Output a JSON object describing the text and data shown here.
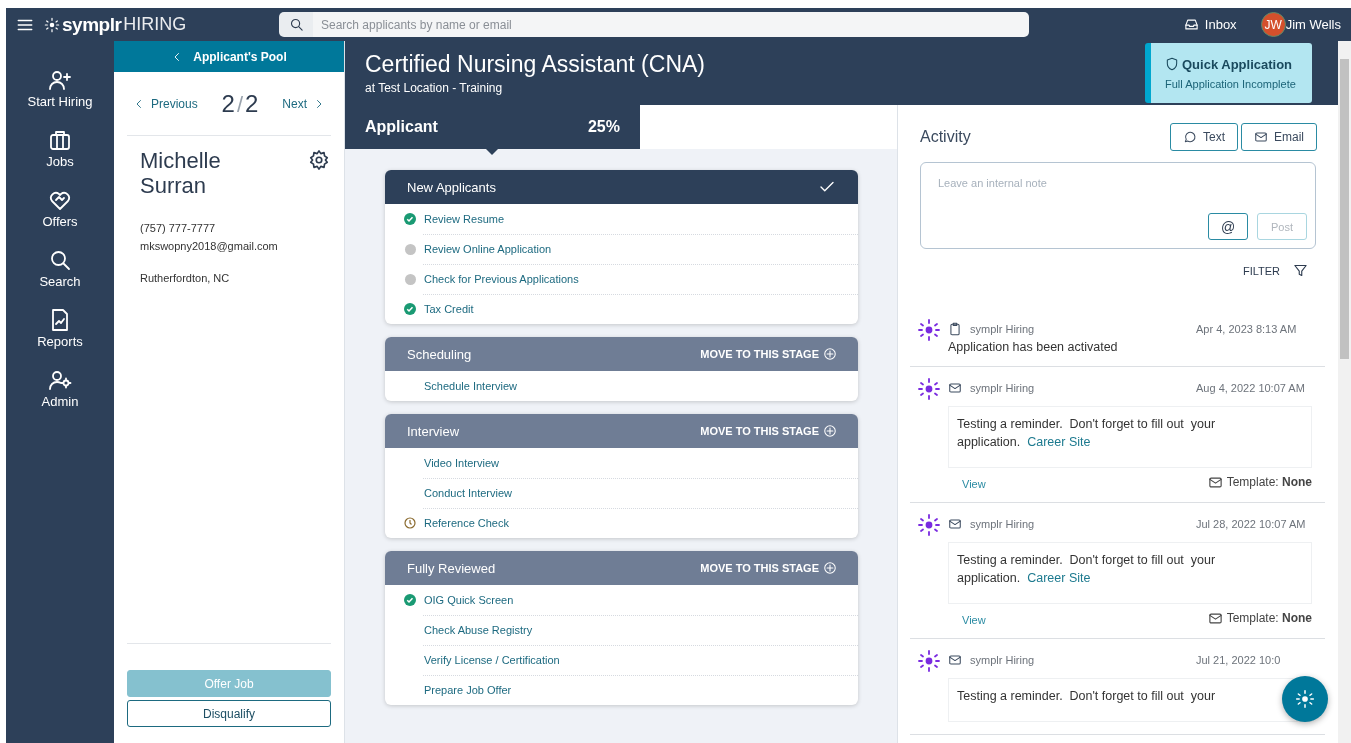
{
  "top_bar": {
    "brand": "symplr",
    "product": "HIRING",
    "search": {
      "placeholder": "Search applicants by name or email"
    },
    "inbox": "Inbox",
    "user": {
      "initials": "JW",
      "name": "Jim Wells"
    }
  },
  "nav": [
    {
      "label": "Start Hiring",
      "kind": "person-add"
    },
    {
      "label": "Jobs",
      "kind": "briefcase"
    },
    {
      "label": "Offers",
      "kind": "heart"
    },
    {
      "label": "Search",
      "kind": "search"
    },
    {
      "label": "Reports",
      "kind": "report"
    },
    {
      "label": "Admin",
      "kind": "person-gear"
    }
  ],
  "applicant": {
    "back": "Applicant's Pool",
    "pager": {
      "previous": "Previous",
      "current": "2",
      "separator": "/",
      "total": "2",
      "next": "Next"
    },
    "name": "Michelle Surran",
    "phone": "(757) 777-7777",
    "email": "mkswopny2018@gmail.com",
    "location": "Rutherfordton, NC",
    "actions": [
      {
        "label": "Offer Job",
        "kind": "primary",
        "disabled": true
      },
      {
        "label": "Disqualify",
        "kind": "outline",
        "disabled": false
      }
    ]
  },
  "job": {
    "title": "Certified Nursing Assistant (CNA)",
    "location": "at Test Location - Training",
    "badge": {
      "title": "Quick Application",
      "subtitle": "Full Application Incomplete"
    }
  },
  "progress": {
    "stage": "Applicant",
    "percent": "25%"
  },
  "stages": [
    {
      "name": "New Applicants",
      "completed": true,
      "tasks": [
        {
          "label": "Review Resume",
          "kind": "done"
        },
        {
          "label": "Review Online Application",
          "kind": "pending"
        },
        {
          "label": "Check for Previous Applications",
          "kind": "pending"
        },
        {
          "label": "Tax Credit",
          "kind": "done"
        }
      ]
    },
    {
      "name": "Scheduling",
      "completed": false,
      "action": "MOVE TO THIS STAGE",
      "tasks": [
        {
          "label": "Schedule Interview",
          "kind": "plain"
        }
      ]
    },
    {
      "name": "Interview",
      "completed": false,
      "action": "MOVE TO THIS STAGE",
      "tasks": [
        {
          "label": "Video Interview",
          "kind": "plain"
        },
        {
          "label": "Conduct Interview",
          "kind": "plain"
        },
        {
          "label": "Reference Check",
          "kind": "waiting"
        }
      ]
    },
    {
      "name": "Fully Reviewed",
      "completed": false,
      "action": "MOVE TO THIS STAGE",
      "tasks": [
        {
          "label": "OIG Quick Screen",
          "kind": "done"
        },
        {
          "label": "Check Abuse Registry",
          "kind": "plain"
        },
        {
          "label": "Verify License / Certification",
          "kind": "plain"
        },
        {
          "label": "Prepare Job Offer",
          "kind": "plain"
        }
      ]
    }
  ],
  "activity": {
    "title": "Activity",
    "buttons": [
      {
        "label": "Text",
        "kind": "chat"
      },
      {
        "label": "Email",
        "kind": "mail"
      }
    ],
    "note": {
      "placeholder": "Leave an internal note",
      "mention": "@",
      "post": {
        "label": "Post",
        "disabled": true
      }
    },
    "filter": "FILTER",
    "items": [
      {
        "kind": "note",
        "source": "symplr Hiring",
        "time": "Apr 4, 2023 8:13 AM",
        "message": "Application has been activated"
      },
      {
        "kind": "email",
        "source": "symplr Hiring",
        "time": "Aug 4, 2022 10:07 AM",
        "message": "Testing a reminder.  Don't forget to fill out  your application.",
        "link": "Career Site",
        "view": "View",
        "template": "Template: **None**"
      },
      {
        "kind": "email",
        "source": "symplr Hiring",
        "time": "Jul 28, 2022 10:07 AM",
        "message": "Testing a reminder.  Don't forget to fill out  your application.",
        "link": "Career Site",
        "view": "View",
        "template": "Template: **None**"
      },
      {
        "kind": "email",
        "source": "symplr Hiring",
        "time": "Jul 21, 2022 10:0",
        "message": "Testing a reminder.  Don't forget to fill out  your"
      }
    ]
  }
}
